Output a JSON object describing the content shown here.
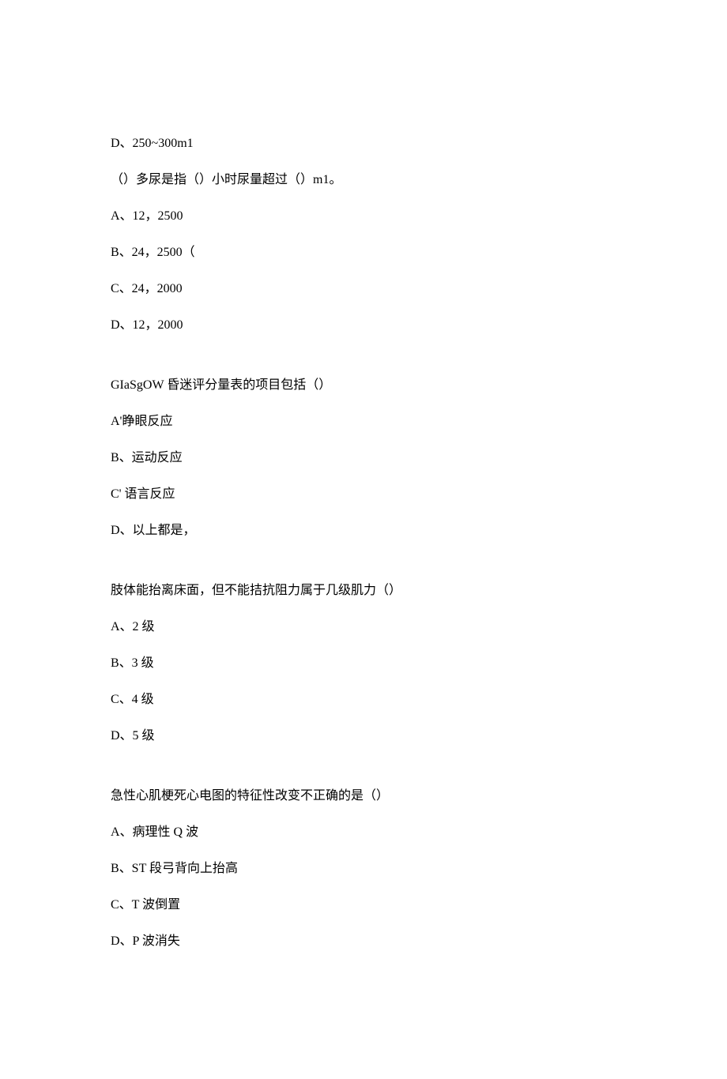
{
  "q1_tail": {
    "optD": "D、250~300m1"
  },
  "q2": {
    "stem": "（）多尿是指（）小时尿量超过（）m1。",
    "optA": "A、12，2500",
    "optB": "B、24，2500（",
    "optC": "C、24，2000",
    "optD": "D、12，2000"
  },
  "q3": {
    "stem": "GIaSgOW 昏迷评分量表的项目包括（）",
    "optA": "A'睁眼反应",
    "optB": "B、运动反应",
    "optC": "C' 语言反应",
    "optD": "D、以上都是，"
  },
  "q4": {
    "stem": "肢体能抬离床面，但不能拮抗阻力属于几级肌力（）",
    "optA": "A、2 级",
    "optB": "B、3 级",
    "optC": "C、4 级",
    "optD": "D、5 级"
  },
  "q5": {
    "stem": "急性心肌梗死心电图的特征性改变不正确的是（）",
    "optA": "A、病理性 Q 波",
    "optB": "B、ST 段弓背向上抬高",
    "optC": "C、T 波倒置",
    "optD": "D、P 波消失"
  }
}
